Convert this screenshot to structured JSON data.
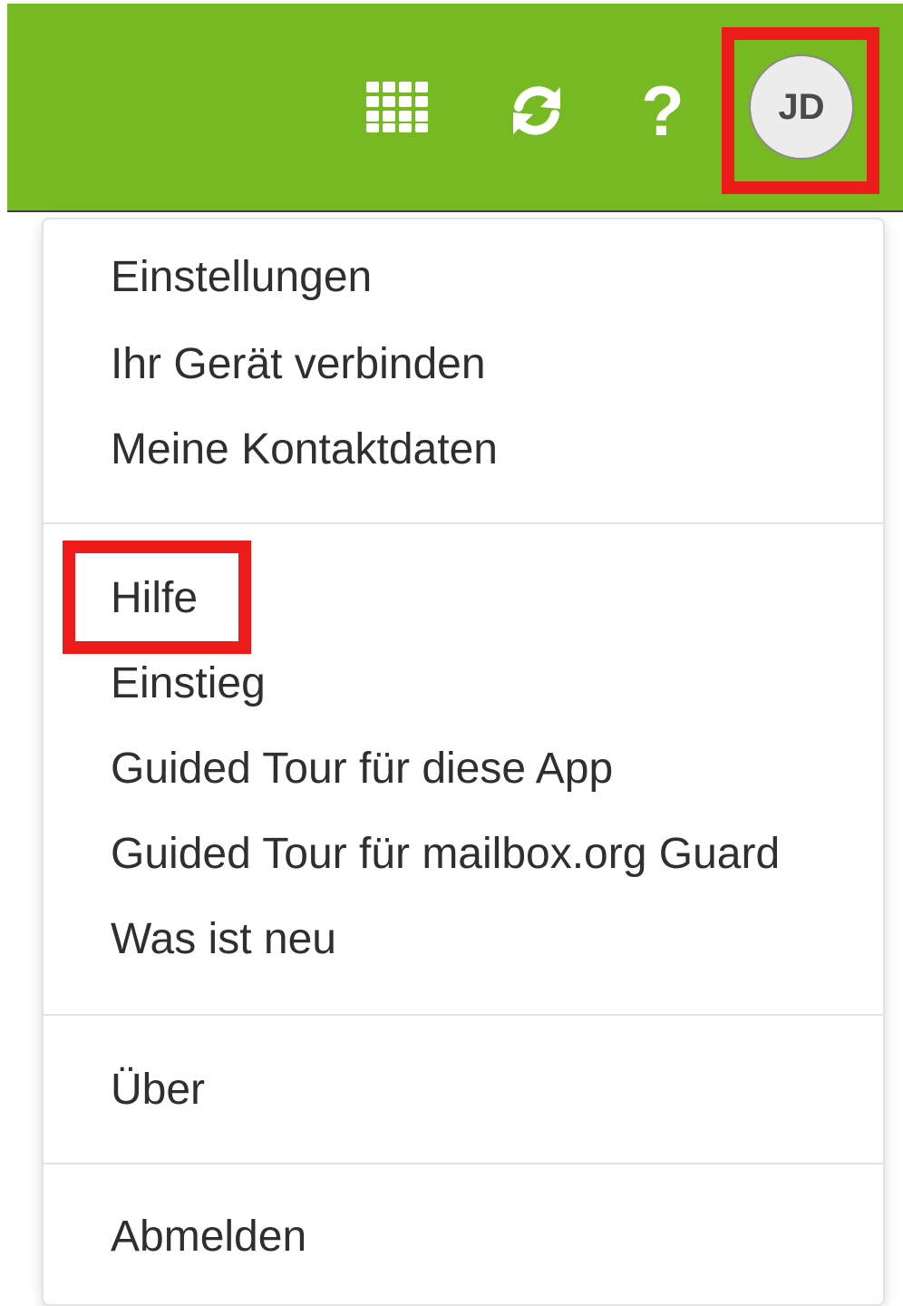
{
  "header": {
    "background_color": "#76b922",
    "icons": {
      "apps": "apps-grid-icon",
      "refresh": "refresh-icon",
      "help": "help-icon"
    },
    "help_glyph": "?",
    "avatar_initials": "JD"
  },
  "menu": {
    "section1": {
      "settings": "Einstellungen",
      "connect_device": "Ihr Gerät verbinden",
      "contact_data": "Meine Kontaktdaten"
    },
    "section2": {
      "help": "Hilfe",
      "getting_started": "Einstieg",
      "guided_tour_app": "Guided Tour für diese App",
      "guided_tour_guard": "Guided Tour für mailbox.org Guard",
      "whats_new": "Was ist neu"
    },
    "section3": {
      "about": "Über"
    },
    "section4": {
      "logout": "Abmelden"
    }
  },
  "highlight_color": "#ee1b1b"
}
